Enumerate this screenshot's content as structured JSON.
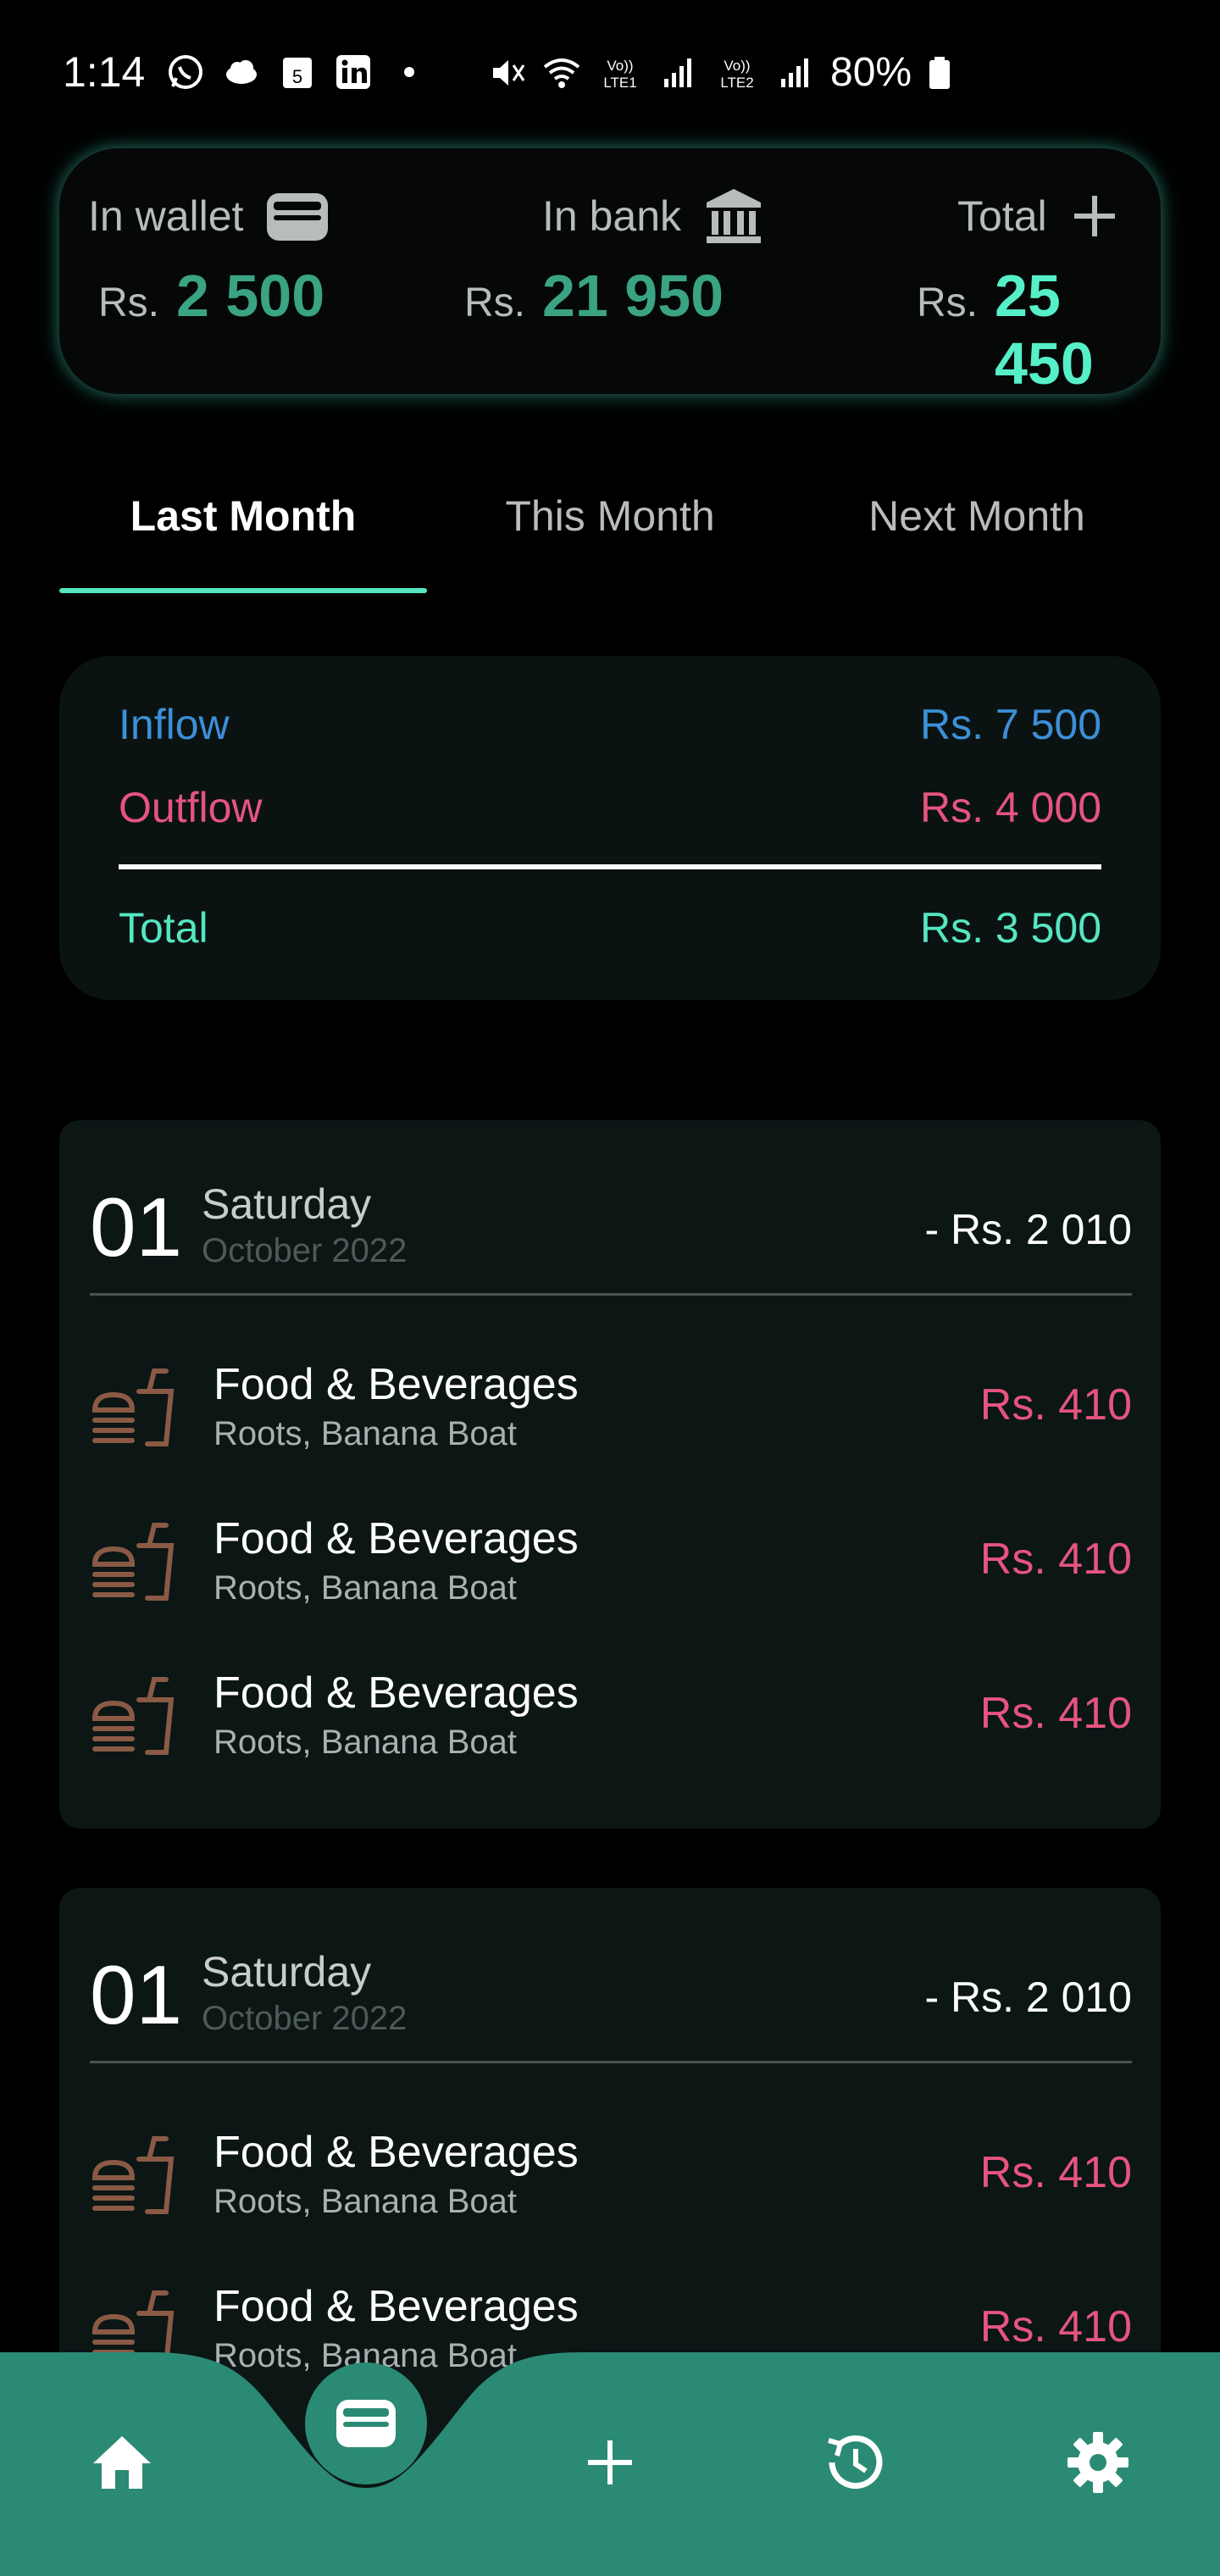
{
  "status_bar": {
    "time": "1:14",
    "battery": "80%",
    "left_icons": [
      "whatsapp-icon",
      "cloud-icon",
      "calendar-icon",
      "linkedin-icon",
      "dot-icon"
    ],
    "calendar_day": "5",
    "right_icons": [
      "mute-icon",
      "wifi-icon",
      "volte1-icon",
      "signal1-icon",
      "volte2-icon",
      "signal2-icon",
      "battery-icon"
    ],
    "volte1_label": "Vo)) LTE1",
    "volte2_label": "Vo)) LTE2"
  },
  "balances": {
    "wallet": {
      "label": "In wallet",
      "currency": "Rs.",
      "amount": "2 500",
      "icon": "wallet-icon"
    },
    "bank": {
      "label": "In bank",
      "currency": "Rs.",
      "amount": "21 950",
      "icon": "bank-icon"
    },
    "total": {
      "label": "Total",
      "currency": "Rs.",
      "amount": "25 450",
      "icon": "plus-icon"
    },
    "accent": "#3aa383",
    "total_accent": "#55f0c8"
  },
  "tabs": [
    {
      "label": "Last Month",
      "active": true
    },
    {
      "label": "This Month",
      "active": false
    },
    {
      "label": "Next Month",
      "active": false
    }
  ],
  "flow": {
    "inflow_label": "Inflow",
    "inflow_value": "Rs. 7 500",
    "outflow_label": "Outflow",
    "outflow_value": "Rs. 4 000",
    "total_label": "Total",
    "total_value": "Rs. 3 500",
    "inflow_color": "#3d8fd8",
    "outflow_color": "#e6547f",
    "total_color": "#55e6c2"
  },
  "days": [
    {
      "day": "01",
      "weekday": "Saturday",
      "month": "October 2022",
      "total": "- Rs. 2 010",
      "transactions": [
        {
          "title": "Food & Beverages",
          "sub": "Roots, Banana Boat",
          "amount": "Rs. 410",
          "icon": "food-icon"
        },
        {
          "title": "Food & Beverages",
          "sub": "Roots, Banana Boat",
          "amount": "Rs. 410",
          "icon": "food-icon"
        },
        {
          "title": "Food & Beverages",
          "sub": "Roots, Banana Boat",
          "amount": "Rs. 410",
          "icon": "food-icon"
        }
      ]
    },
    {
      "day": "01",
      "weekday": "Saturday",
      "month": "October 2022",
      "total": "- Rs. 2 010",
      "transactions": [
        {
          "title": "Food & Beverages",
          "sub": "Roots, Banana Boat",
          "amount": "Rs. 410",
          "icon": "food-icon"
        },
        {
          "title": "Food & Beverages",
          "sub": "Roots, Banana Boat",
          "amount": "Rs. 410",
          "icon": "food-icon"
        }
      ]
    }
  ],
  "bottom_nav": {
    "items": [
      "home-icon",
      "wallet-icon",
      "plus-icon",
      "history-icon",
      "settings-icon"
    ],
    "active": "wallet-icon",
    "color": "#2b8a73"
  }
}
